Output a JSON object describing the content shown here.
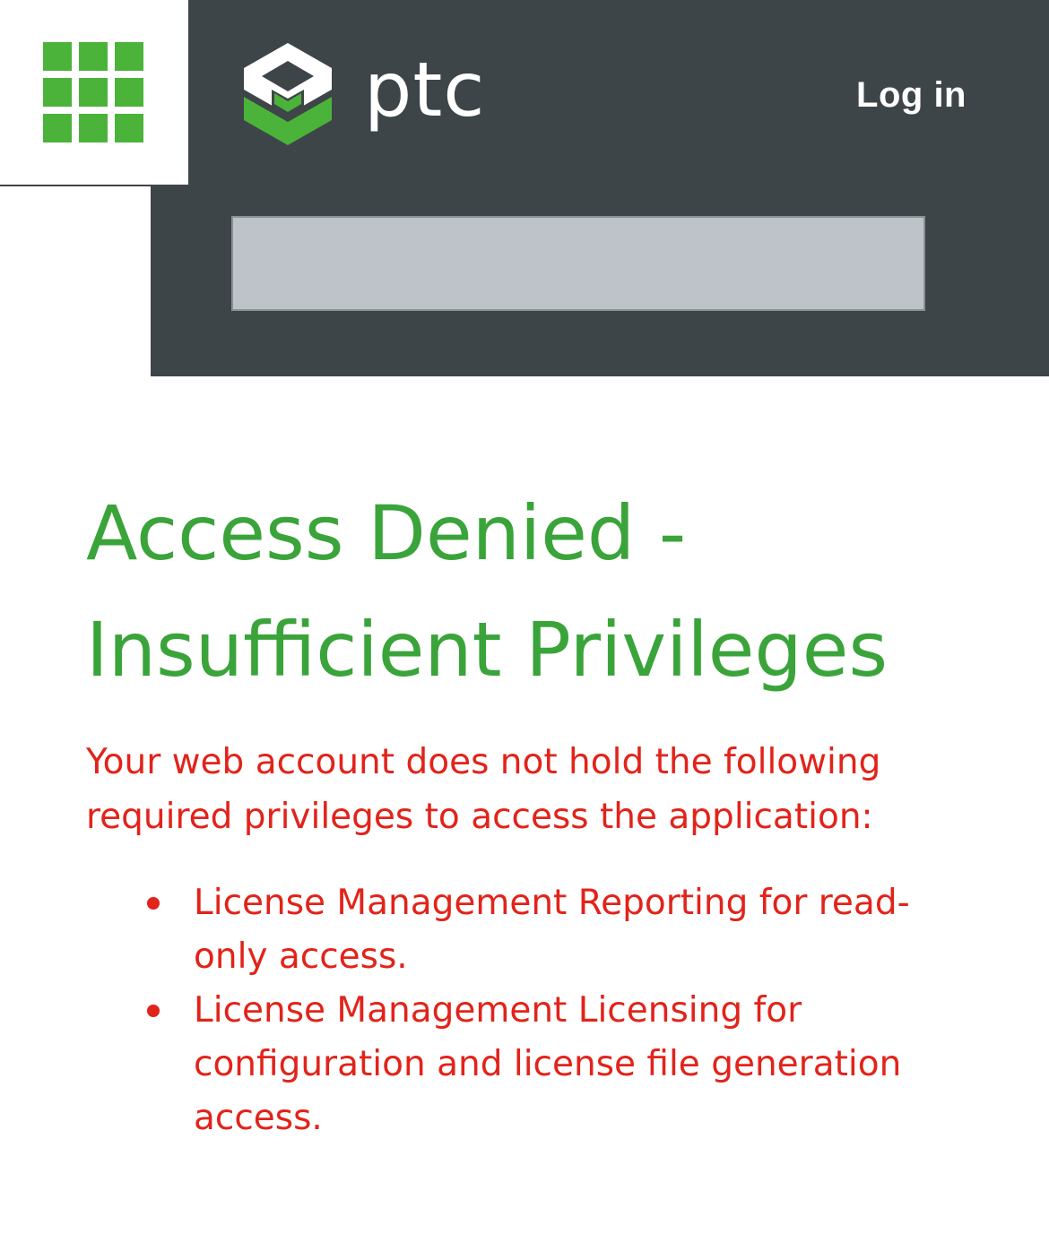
{
  "brand": {
    "name": "ptc",
    "colors": {
      "green": "#4bb33a",
      "header_bg": "#3e4548",
      "title": "#3aa43a",
      "error": "#e2231a"
    }
  },
  "header": {
    "launcher_icon": "app-grid-icon",
    "login_label": "Log in"
  },
  "main": {
    "title_line1": "Access Denied -",
    "title_line2": "Insufficient Privileges",
    "message": "Your web account does not hold the following required privileges to access the application:",
    "privileges": [
      "License Management Reporting for read-only access.",
      "License Management Licensing for configuration and license file generation access."
    ]
  }
}
